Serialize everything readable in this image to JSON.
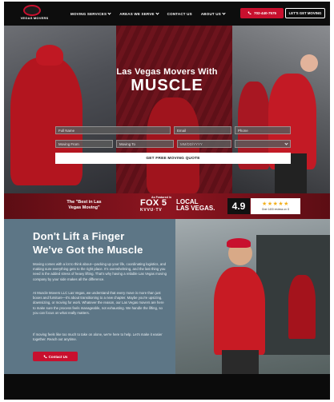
{
  "header": {
    "logo_text": "VEGAS MOVERS",
    "nav": [
      "MOVING SERVICES",
      "AREAS WE SERVE",
      "CONTACT US",
      "ABOUT US"
    ],
    "phone": "702-440-7575",
    "cta": "LET'S GET MOVING"
  },
  "hero": {
    "title_line1": "Las Vegas Movers With",
    "title_line2": "MUSCLE",
    "form": {
      "full_name": "Full Name",
      "email": "Email",
      "phone": "Phone",
      "moving_from": "Moving From",
      "moving_to": "Moving To",
      "date": "MM/DD/YYYY",
      "submit": "GET FREE MOVING QUOTE"
    }
  },
  "banner": {
    "best_line1": "The \"Best in Las",
    "best_line2": "Vegas Moving\"",
    "featured": "As Featured In",
    "fox": "FOX 5",
    "kvvu": "KVVU·TV",
    "local1": "LOCAL",
    "local2": "LAS VEGAS.",
    "rating": "4.9",
    "stars": "★★★★★",
    "review_text": "Over 1400 reviews on G"
  },
  "content": {
    "heading_line1": "Don't Lift a Finger",
    "heading_line2": "We've Got the Muscle",
    "para1": "Moving comes with a lot to think about—packing up your life, coordinating logistics, and making sure everything gets to the right place. It's overwhelming, and the last thing you need is the added stress of heavy lifting. That's why having a reliable Las Vegas moving company by your side makes all the difference.",
    "para2": "At Muscle Movers LLC Las Vegas, we understand that every move is more than just boxes and furniture—it's about transitioning to a new chapter. Maybe you're upsizing, downsizing, or moving for work. Whatever the reason, our Las Vegas movers are here to make sure the process feels manageable, not exhausting. We handle the lifting, so you can focus on what really matters.",
    "para3": "If moving feels like too much to take on alone, we're here to help. Let's make it easier together. Reach out anytime.",
    "contact_button": "Contact Us"
  },
  "colors": {
    "accent": "#c8102e",
    "header_bg": "#0d0d0d",
    "content_bg": "#5d7686"
  }
}
